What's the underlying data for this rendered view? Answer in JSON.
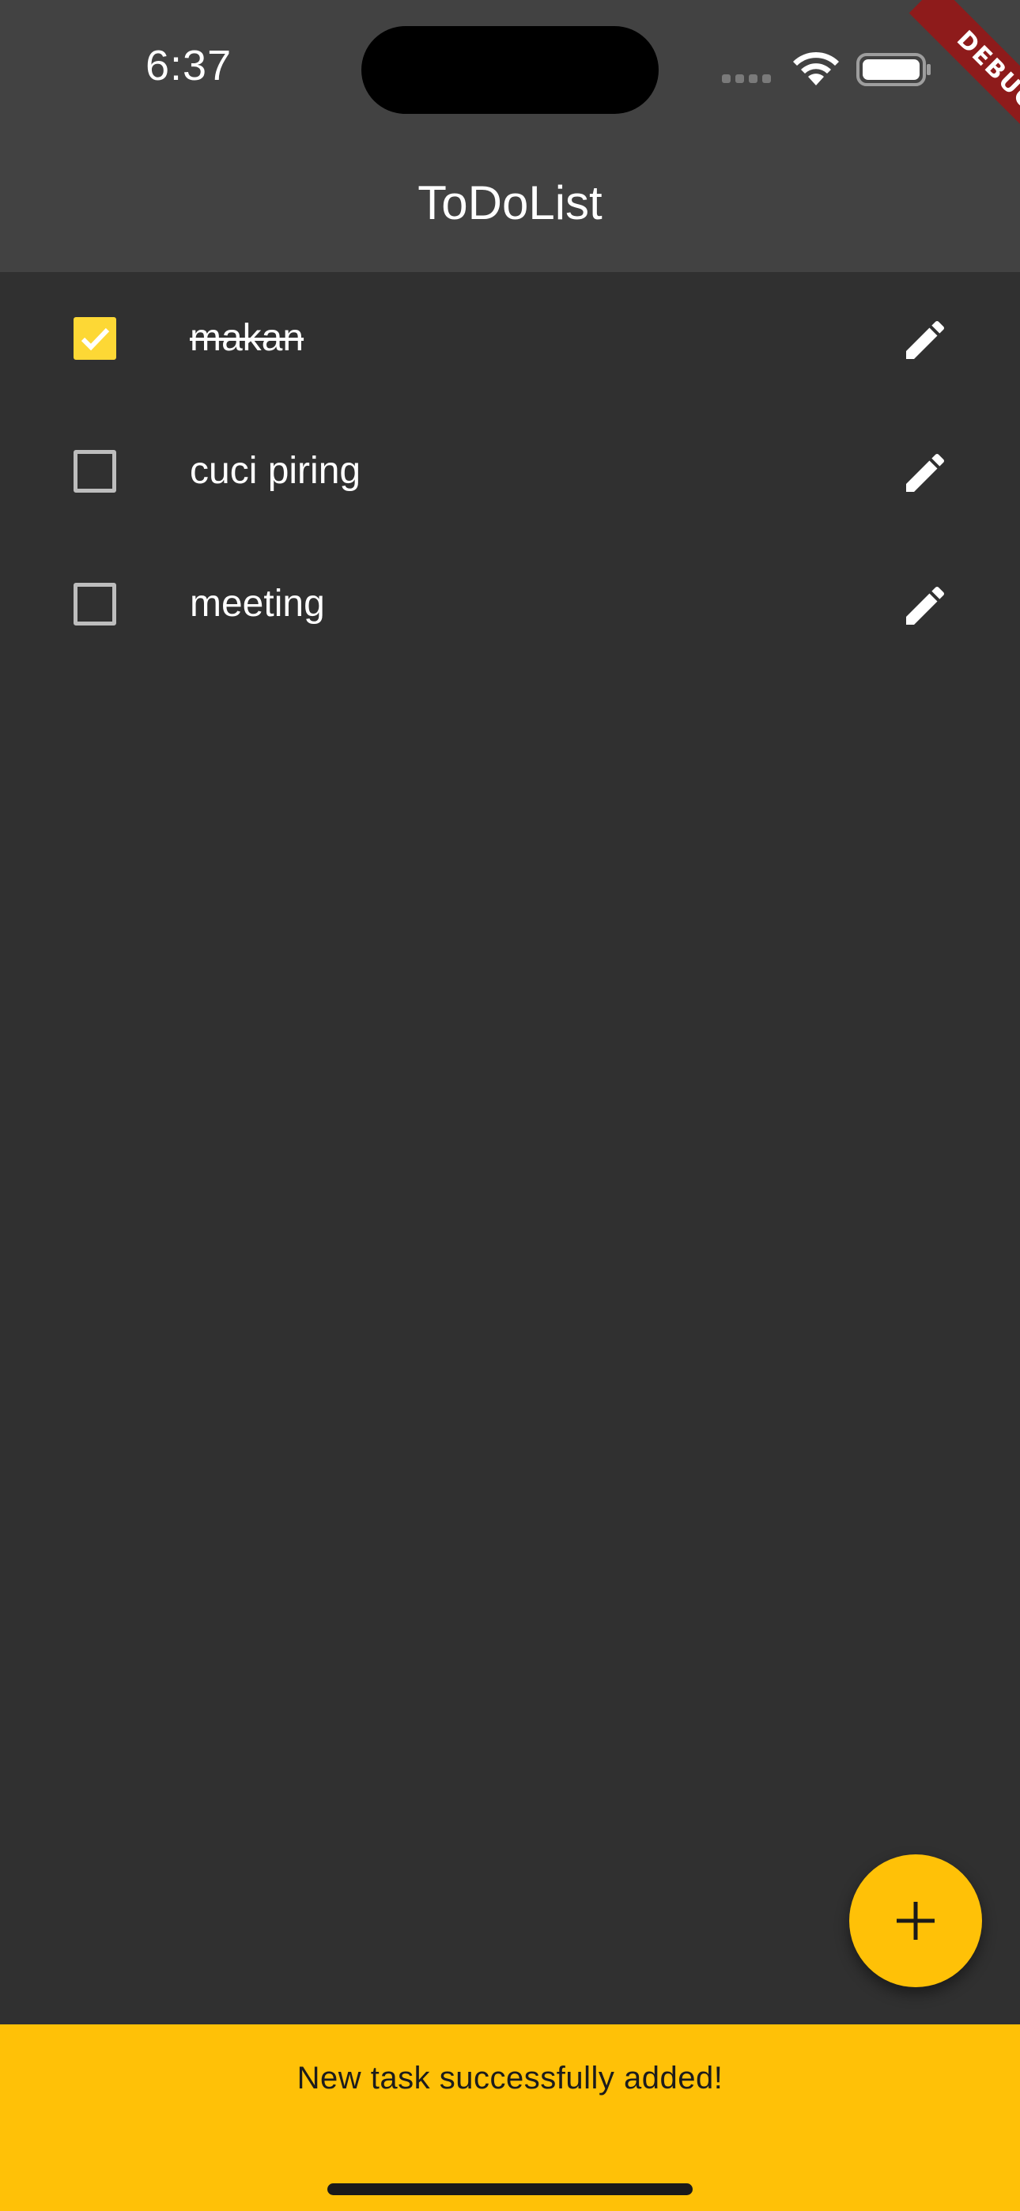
{
  "status_bar": {
    "time": "6:37"
  },
  "debug_banner": "DEBUG",
  "app_bar": {
    "title": "ToDoList"
  },
  "tasks": [
    {
      "label": "makan",
      "done": true
    },
    {
      "label": "cuci piring",
      "done": false
    },
    {
      "label": "meeting",
      "done": false
    }
  ],
  "icons": {
    "checkbox": "check-icon",
    "edit": "pencil-icon",
    "fab": "plus-icon"
  },
  "colors": {
    "accent": "#ffc107",
    "checkbox_checked": "#fdd835",
    "background": "#303030",
    "app_bar": "#424242",
    "debug_ribbon": "#8e1b1b"
  },
  "snackbar": {
    "message": "New task successfully added!"
  }
}
